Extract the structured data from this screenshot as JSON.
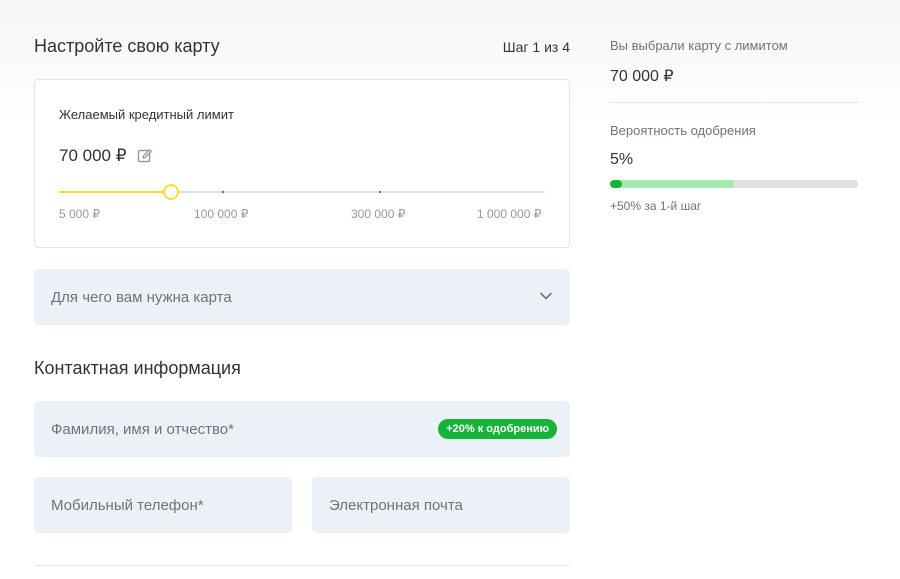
{
  "header": {
    "title": "Настройте свою карту",
    "step": "Шаг 1 из 4"
  },
  "limit_card": {
    "label": "Желаемый кредитный лимит",
    "value": "70 000 ₽",
    "edit_icon": "pencil-edit-icon",
    "slider": {
      "current_value": 70000,
      "ticks": [
        "5 000 ₽",
        "100 000 ₽",
        "300 000 ₽",
        "1 000 000 ₽"
      ]
    }
  },
  "purpose": {
    "placeholder": "Для чего вам нужна карта",
    "icon": "chevron-down-icon"
  },
  "contact": {
    "title": "Контактная информация",
    "full_name_placeholder": "Фамилия, имя и отчество*",
    "full_name_badge": "+20% к одобрению",
    "phone_placeholder": "Мобильный телефон*",
    "email_placeholder": "Электронная почта"
  },
  "sidebar": {
    "selected_label": "Вы выбрали карту с лимитом",
    "selected_value": "70 000 ₽",
    "probability_label": "Вероятность одобрения",
    "probability_value": "5%",
    "probability_current_pct": 5,
    "probability_potential_pct": 50,
    "hint": "+50% за 1-й шаг"
  },
  "colors": {
    "accent_yellow": "#ffdd2d",
    "success_green": "#15b337",
    "light_green": "#a5e8b0",
    "field_bg": "#ecf1f7"
  }
}
